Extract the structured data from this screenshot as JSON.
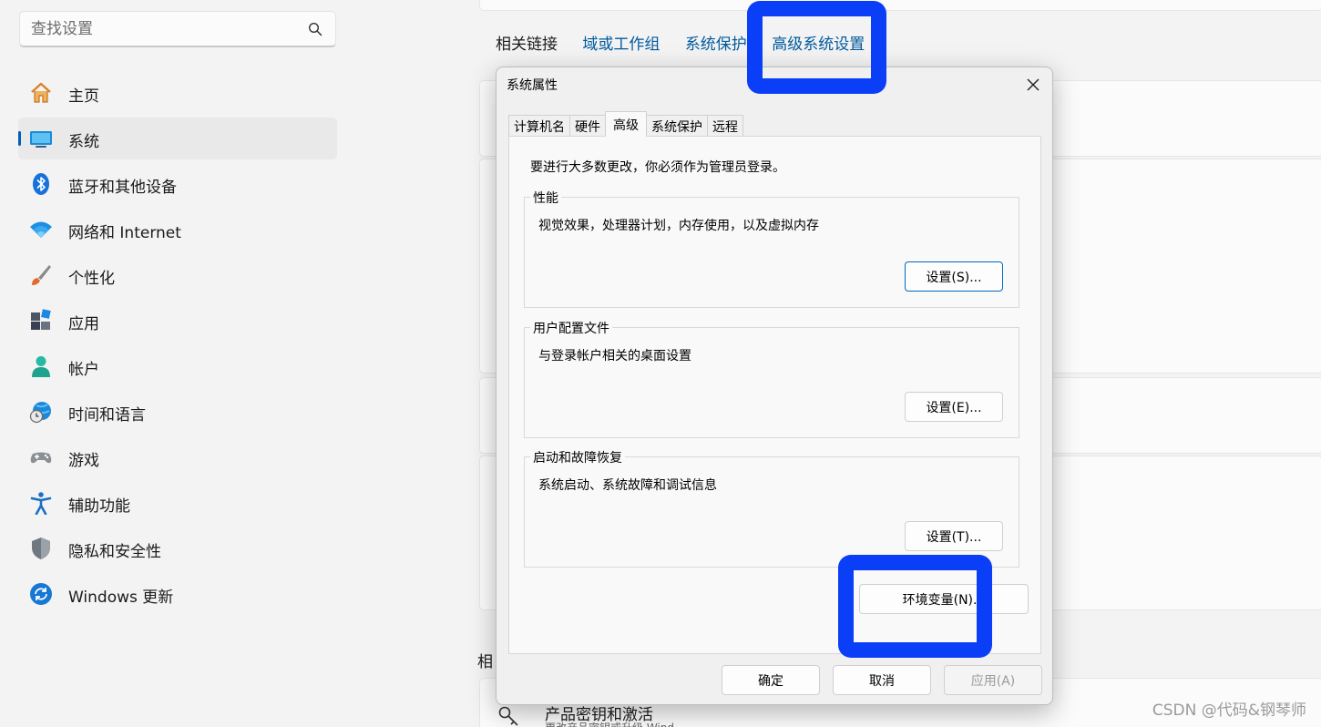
{
  "search": {
    "placeholder": "查找设置"
  },
  "sidebar": {
    "items": [
      {
        "label": "主页",
        "icon": "home-icon"
      },
      {
        "label": "系统",
        "icon": "system-icon",
        "selected": true
      },
      {
        "label": "蓝牙和其他设备",
        "icon": "bluetooth-icon"
      },
      {
        "label": "网络和 Internet",
        "icon": "wifi-icon"
      },
      {
        "label": "个性化",
        "icon": "brush-icon"
      },
      {
        "label": "应用",
        "icon": "apps-icon"
      },
      {
        "label": "帐户",
        "icon": "account-icon"
      },
      {
        "label": "时间和语言",
        "icon": "time-language-icon"
      },
      {
        "label": "游戏",
        "icon": "gamepad-icon"
      },
      {
        "label": "辅助功能",
        "icon": "accessibility-icon"
      },
      {
        "label": "隐私和安全性",
        "icon": "shield-icon"
      },
      {
        "label": "Windows 更新",
        "icon": "update-icon"
      }
    ]
  },
  "content": {
    "related_links": {
      "title": "相关链接",
      "links": [
        "域或工作组",
        "系统保护",
        "高级系统设置"
      ]
    },
    "related_title": "相",
    "product": {
      "title": "产品密钥和激活",
      "subtitle": "更改产品密钥或升级 Wind"
    }
  },
  "dialog": {
    "title": "系统属性",
    "tabs": [
      "计算机名",
      "硬件",
      "高级",
      "系统保护",
      "远程"
    ],
    "active_tab": "高级",
    "admin_note": "要进行大多数更改，你必须作为管理员登录。",
    "groups": [
      {
        "title": "性能",
        "desc": "视觉效果，处理器计划，内存使用，以及虚拟内存",
        "button": "设置(S)..."
      },
      {
        "title": "用户配置文件",
        "desc": "与登录帐户相关的桌面设置",
        "button": "设置(E)..."
      },
      {
        "title": "启动和故障恢复",
        "desc": "系统启动、系统故障和调试信息",
        "button": "设置(T)..."
      }
    ],
    "env_button": "环境变量(N)...",
    "ok": "确定",
    "cancel": "取消",
    "apply": "应用(A)"
  },
  "watermark": "CSDN @代码&钢琴师",
  "colors": {
    "accent": "#005fb8",
    "link": "#005a9e",
    "marker": "#0b3ff7"
  }
}
